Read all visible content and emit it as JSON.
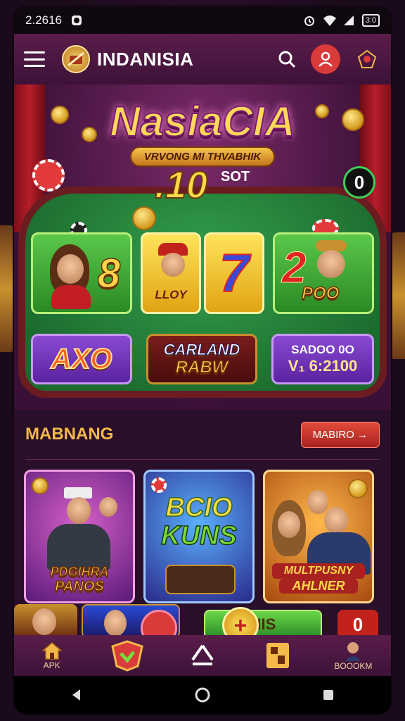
{
  "status_bar": {
    "time": "2.2616",
    "battery": "3:0"
  },
  "app_bar": {
    "title": "INDANISIA"
  },
  "hero": {
    "banner_title": "NasiaCIA",
    "banner_subtitle": "VRVONG MI THVABHIK",
    "amount": ".10",
    "slot_label": "SOT",
    "zero_badge": "0",
    "tiles": {
      "green_left_glyph": "8",
      "gold_left_label": "LLOY",
      "gold_right_glyph": "7",
      "green_right_glyph": "2",
      "green_right_label": "POO",
      "purple_left_label": "AXO",
      "maroon_line1": "CARLAND",
      "maroon_line2": "RABW",
      "purple_right_line1": "SADOO 0O",
      "purple_right_line2": "V₁ 6:2100"
    }
  },
  "section": {
    "title": "MABNANG",
    "more_button": "MABIRO →"
  },
  "cards": [
    {
      "line1": "PDGIHRA",
      "line2": "PANOS"
    },
    {
      "line1": "BCIO",
      "line2": "KUNS"
    },
    {
      "line1": "MULTPUSNY",
      "line2": "AHLNER"
    }
  ],
  "row2": {
    "green_label": "NIS",
    "red_label": "0"
  },
  "bottom_nav": {
    "apk": "APK",
    "bookm": "BOOOKM"
  },
  "colors": {
    "accent": "#f4b94a",
    "appbar": "#5a1d4a",
    "felt": "#2a8a24"
  }
}
